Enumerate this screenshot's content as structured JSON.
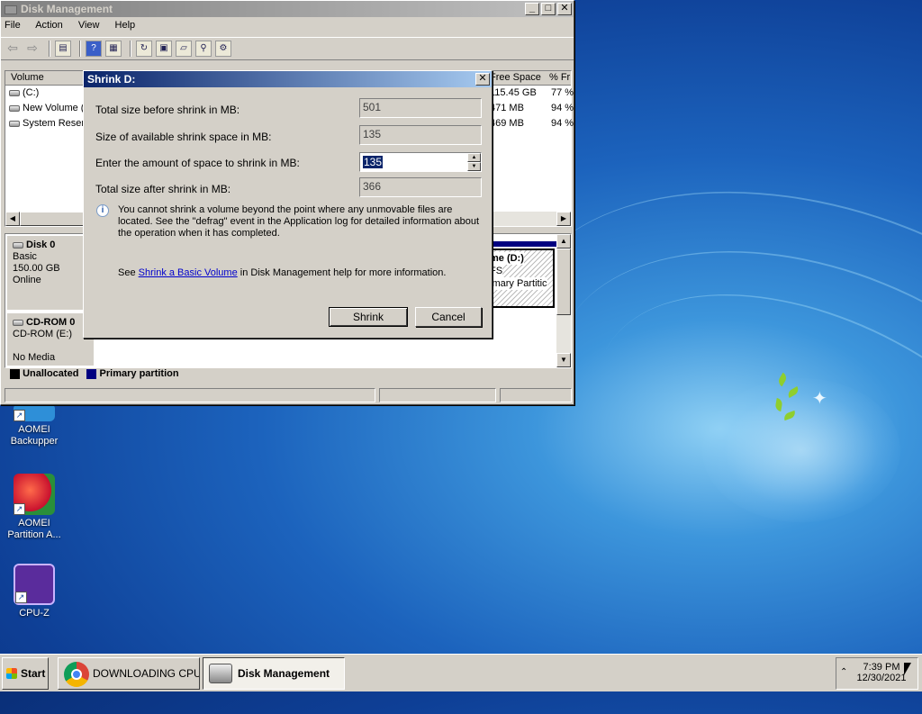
{
  "desktop": {
    "icons": [
      {
        "label_1": "AOMEI",
        "label_2": "Backupper"
      },
      {
        "label_1": "AOMEI",
        "label_2": "Partition A..."
      },
      {
        "label_1": "CPU-Z",
        "label_2": ""
      }
    ]
  },
  "disk_management": {
    "title": "Disk Management",
    "menu": [
      "File",
      "Action",
      "View",
      "Help"
    ],
    "columns": {
      "volume": "Volume",
      "free_space": "Free Space",
      "percent_free": "% Fr"
    },
    "volumes": [
      {
        "name": "(C:)",
        "free": "115.45 GB",
        "pct": "77 %"
      },
      {
        "name": "New Volume (",
        "free": "471 MB",
        "pct": "94 %"
      },
      {
        "name": "System Reser",
        "free": "469 MB",
        "pct": "94 %"
      }
    ],
    "disk0": {
      "name": "Disk 0",
      "type": "Basic",
      "size": "150.00 GB",
      "status": "Online"
    },
    "cdrom0": {
      "name": "CD-ROM 0",
      "type": "CD-ROM (E:)",
      "status": "No Media"
    },
    "partition_d": {
      "line1": "me (D:)",
      "line2": "FS",
      "line3": "imary Partitic"
    },
    "legend": {
      "unallocated": "Unallocated",
      "primary": "Primary partition"
    },
    "colors": {
      "unallocated": "#000000",
      "primary": "#000080"
    }
  },
  "shrink_dialog": {
    "title": "Shrink D:",
    "total_before_label": "Total size before shrink in MB:",
    "total_before_value": "501",
    "available_label": "Size of available shrink space in MB:",
    "available_value": "135",
    "enter_label": "Enter the amount of space to shrink in MB:",
    "enter_value": "135",
    "total_after_label": "Total size after shrink in MB:",
    "total_after_value": "366",
    "info_text": "You cannot shrink a volume beyond the point where any unmovable files are located. See the \"defrag\" event in the Application log for detailed information about the operation when it has completed.",
    "see_prefix": "See",
    "see_link": "Shrink a Basic Volume",
    "see_suffix": "in Disk Management help for more information.",
    "shrink_button": "Shrink",
    "cancel_button": "Cancel"
  },
  "taskbar": {
    "start": "Start",
    "items": [
      {
        "label": "DOWNLOADING CPU-..."
      },
      {
        "label": "Disk Management"
      }
    ],
    "time": "7:39 PM",
    "date": "12/30/2021"
  }
}
